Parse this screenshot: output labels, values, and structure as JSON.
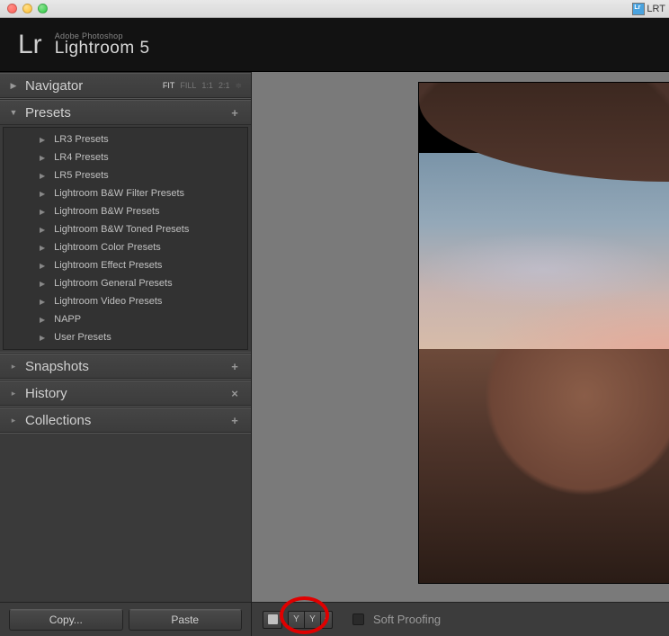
{
  "titlebar": {
    "right_label": "LRT"
  },
  "header": {
    "adobe": "Adobe Photoshop",
    "product": "Lightroom 5",
    "logo": "Lr"
  },
  "navigator": {
    "title": "Navigator",
    "zoom": {
      "fit": "FIT",
      "fill": "FILL",
      "one": "1:1",
      "two": "2:1"
    }
  },
  "presets": {
    "title": "Presets",
    "items": [
      "LR3 Presets",
      "LR4 Presets",
      "LR5 Presets",
      "Lightroom B&W Filter Presets",
      "Lightroom B&W Presets",
      "Lightroom B&W Toned Presets",
      "Lightroom Color Presets",
      "Lightroom Effect Presets",
      "Lightroom General Presets",
      "Lightroom Video Presets",
      "NAPP",
      "User Presets"
    ]
  },
  "snapshots": {
    "title": "Snapshots"
  },
  "history": {
    "title": "History"
  },
  "collections": {
    "title": "Collections"
  },
  "buttons": {
    "copy": "Copy...",
    "paste": "Paste"
  },
  "toolbar": {
    "compare_y": "Y",
    "soft_proofing": "Soft Proofing"
  }
}
